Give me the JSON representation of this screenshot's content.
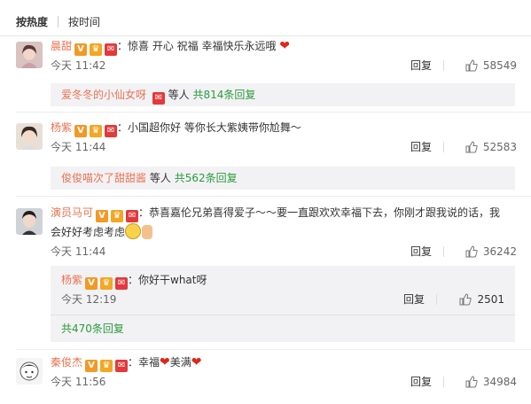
{
  "tabs": {
    "hot": "按热度",
    "time": "按时间"
  },
  "comments": [
    {
      "name": "晨甜",
      "text": "：惊喜 开心 祝福 幸福快乐永远哦",
      "time": "今天 11:42",
      "reply_label": "回复",
      "likes": "58549",
      "thread": {
        "first_name": "爱冬冬的小仙女呀",
        "suffix": "等人",
        "count_text": "共814条回复"
      }
    },
    {
      "name": "杨紫",
      "text": "：小国超你好 等你长大紫姨带你尬舞～",
      "time": "今天 11:44",
      "reply_label": "回复",
      "likes": "52583",
      "thread": {
        "first_name": "俊俊喵次了甜甜酱",
        "suffix": "等人",
        "count_text": "共562条回复"
      }
    },
    {
      "name": "演员马可",
      "text_line1": "：恭喜嘉伦兄弟喜得爱子～～要一直跟欢欢幸福下去，你刚才跟我说的话，我",
      "text_line2": "会好好考虑考虑",
      "time": "今天 11:44",
      "reply_label": "回复",
      "likes": "36242",
      "sub_reply": {
        "name": "杨紫",
        "text": "：你好干what呀",
        "time": "今天 12:19",
        "reply_label": "回复",
        "likes": "2501"
      },
      "thread_count": "共470条回复"
    },
    {
      "name": "秦俊杰",
      "text_a": "：幸福",
      "text_b": "美满",
      "time": "今天 11:56",
      "reply_label": "回复",
      "likes": "34984"
    }
  ]
}
